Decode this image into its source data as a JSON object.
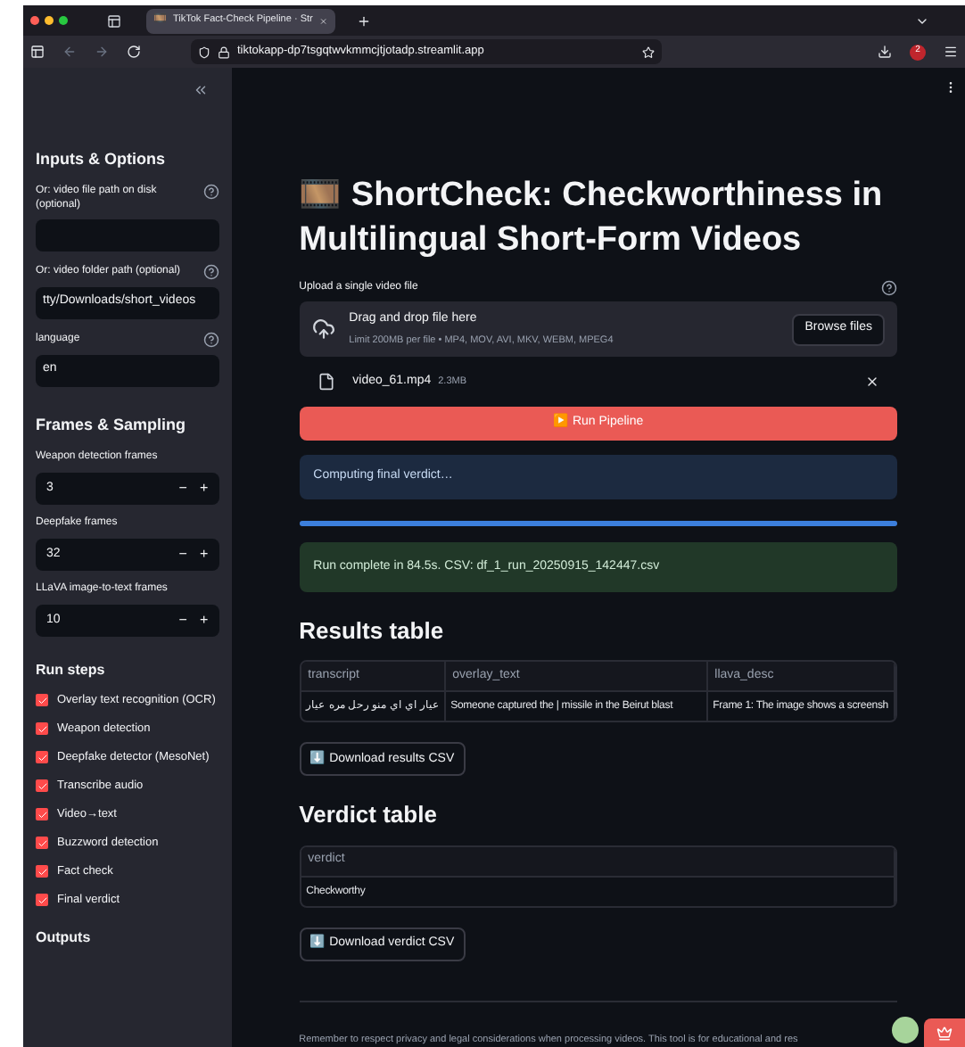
{
  "browser": {
    "tab_title": "TikTok Fact-Check Pipeline · Str",
    "url": "tiktokapp-dp7tsgqtwvkmmcjtjotadp.streamlit.app",
    "extension_badge": "2"
  },
  "sidebar": {
    "title": "Inputs & Options",
    "fields": [
      {
        "label": "Or: video file path on disk (optional)",
        "help": true
      },
      {
        "label": "Or: video folder path (optional)",
        "value": "tty/Downloads/short_videos",
        "help": true
      },
      {
        "label": "language",
        "value": "en",
        "help": true
      }
    ],
    "frames_title": "Frames & Sampling",
    "numbers": [
      {
        "label": "Weapon detection frames",
        "value": "3",
        "decrement": "−",
        "increment": "+"
      },
      {
        "label": "Deepfake frames",
        "value": "32",
        "decrement": "−",
        "increment": "+"
      },
      {
        "label": "LLaVA image-to-text frames",
        "value": "10",
        "decrement": "−",
        "increment": "+"
      }
    ],
    "steps_title": "Run steps",
    "steps": [
      {
        "label": "Overlay text recognition (OCR)",
        "checked": true
      },
      {
        "label": "Weapon detection",
        "checked": true
      },
      {
        "label": "Deepfake detector (MesoNet)",
        "checked": true
      },
      {
        "label": "Transcribe audio",
        "checked": true
      },
      {
        "label": "Video→text",
        "checked": true
      },
      {
        "label": "Buzzword detection",
        "checked": true
      },
      {
        "label": "Fact check",
        "checked": true
      },
      {
        "label": "Final verdict",
        "checked": true
      }
    ],
    "outputs_title": "Outputs"
  },
  "main": {
    "title_icon": "🎞️",
    "title": "ShortCheck: Checkworthiness in Multilingual Short-Form Videos",
    "upload": {
      "label": "Upload a single video file",
      "drop_text": "Drag and drop file here",
      "limit": "Limit 200MB per file • MP4, MOV, AVI, MKV, WEBM, MPEG4",
      "browse": "Browse files",
      "file_name": "video_61.mp4",
      "file_size": "2.3MB"
    },
    "run_button": "▶️ Run Pipeline",
    "status": "Computing final verdict…",
    "progress": {
      "level": 1
    },
    "success": "Run complete in 84.5s. CSV: df_1_run_20250915_142447.csv",
    "results_title": "Results table",
    "results": {
      "columns": [
        "transcript",
        "overlay_text",
        "llava_desc"
      ],
      "rows": [
        [
          "عيار اي اي منو رحل مره عيار",
          "Someone captured the | missile in the Beirut blast",
          "Frame 1: The image shows a screensh"
        ]
      ]
    },
    "download_results": "⬇️ Download results CSV",
    "verdict_title": "Verdict table",
    "verdict": {
      "columns": [
        "verdict"
      ],
      "rows": [
        [
          "Checkworthy"
        ]
      ]
    },
    "download_verdict": "⬇️ Download verdict CSV",
    "footer": "Remember to respect privacy and legal considerations when processing videos. This tool is for educational and res"
  }
}
